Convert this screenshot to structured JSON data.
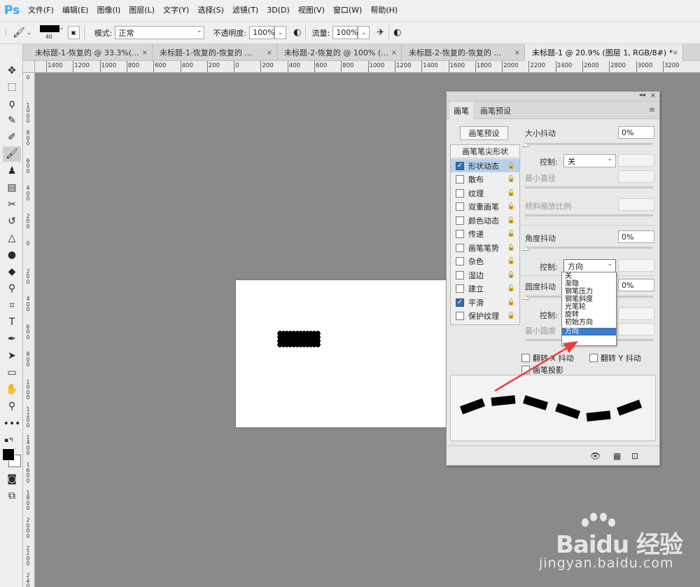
{
  "app": {
    "logo": "Ps"
  },
  "menu": [
    "文件(F)",
    "编辑(E)",
    "图像(I)",
    "图层(L)",
    "文字(Y)",
    "选择(S)",
    "滤镜(T)",
    "3D(D)",
    "视图(V)",
    "窗口(W)",
    "帮助(H)"
  ],
  "options_bar": {
    "brush_size": "40",
    "mode_label": "模式:",
    "mode_value": "正常",
    "opacity_label": "不透明度:",
    "opacity_value": "100%",
    "flow_label": "流量:",
    "flow_value": "100%",
    "brush_color": "#000000"
  },
  "tabs": [
    {
      "label": "未标题-1-恢复的 @ 33.3%(...",
      "active": false
    },
    {
      "label": "未标题-1-恢复的-恢复的 ...",
      "active": false
    },
    {
      "label": "未标题-2-恢复的 @ 100% (...",
      "active": false
    },
    {
      "label": "未标题-2-恢复的-恢复的 ...",
      "active": false
    },
    {
      "label": "未标题-1 @ 20.9% (图层 1, RGB/8#) *",
      "active": true
    }
  ],
  "tab_close": "×",
  "ruler": {
    "h_ticks": [
      "1400",
      "1200",
      "1000",
      "800",
      "600",
      "400",
      "200",
      "0",
      "200",
      "400",
      "600",
      "800",
      "1000",
      "1200",
      "1400",
      "1600",
      "1800",
      "2000",
      "2200",
      "2400",
      "2600",
      "2800",
      "3000",
      "3200"
    ],
    "v_ticks": [
      "0",
      "1000",
      "800",
      "600",
      "400",
      "200",
      "0",
      "200",
      "400",
      "600",
      "800",
      "1000",
      "1200",
      "1400",
      "1600",
      "1800",
      "2000",
      "2200",
      "2400"
    ]
  },
  "tools": [
    "move-icon",
    "marquee-icon",
    "lasso-icon",
    "quick-select-icon",
    "eyedropper-icon",
    "brush-icon",
    "stamp-icon",
    "gradient-icon",
    "healing-icon",
    "history-brush-icon",
    "blur-icon",
    "burn-icon",
    "eraser-icon",
    "eyedropper2-icon",
    "crop-icon",
    "text-icon",
    "pen-icon",
    "path-select-icon",
    "rectangle-icon",
    "hand-icon",
    "zoom-icon",
    "more-icon"
  ],
  "brush_panel": {
    "tabs": [
      "画笔",
      "画笔预设"
    ],
    "preset_button": "画笔预设",
    "list_header": "画笔笔尖形状",
    "items": [
      {
        "label": "形状动态",
        "checked": true,
        "selected": true
      },
      {
        "label": "散布",
        "checked": false
      },
      {
        "label": "纹理",
        "checked": false
      },
      {
        "label": "双重画笔",
        "checked": false
      },
      {
        "label": "颜色动态",
        "checked": false
      },
      {
        "label": "传递",
        "checked": false
      },
      {
        "label": "画笔笔势",
        "checked": false
      },
      {
        "label": "杂色",
        "checked": false
      },
      {
        "label": "湿边",
        "checked": false
      },
      {
        "label": "建立",
        "checked": false
      },
      {
        "label": "平滑",
        "checked": true
      },
      {
        "label": "保护纹理",
        "checked": false
      }
    ],
    "size_jitter_label": "大小抖动",
    "size_jitter_value": "0%",
    "control_label": "控制:",
    "size_control_value": "关",
    "min_diameter_label": "最小直径",
    "tilt_scale_label": "倾斜缩放比例",
    "angle_jitter_label": "角度抖动",
    "angle_jitter_value": "0%",
    "angle_control_value": "方向",
    "roundness_jitter_label": "圆度抖动",
    "roundness_jitter_value": "0%",
    "roundness_control_label": "控制:",
    "min_roundness_label": "最小圆度",
    "flip_x_label": "翻转 X 抖动",
    "flip_y_label": "翻转 Y 抖动",
    "projection_label": "画笔投影",
    "dropdown_options": [
      "关",
      "渐隐",
      "钢笔压力",
      "钢笔斜度",
      "光笔轮",
      "旋转",
      "初始方向",
      "方向"
    ],
    "dropdown_highlight_index": 7
  },
  "watermark": {
    "brand": "Baidu 经验",
    "url": "jingyan.baidu.com"
  },
  "colors": {
    "accent": "#3d7bc6",
    "arrow": "#e8403a",
    "workspace": "#8a8a8a"
  }
}
